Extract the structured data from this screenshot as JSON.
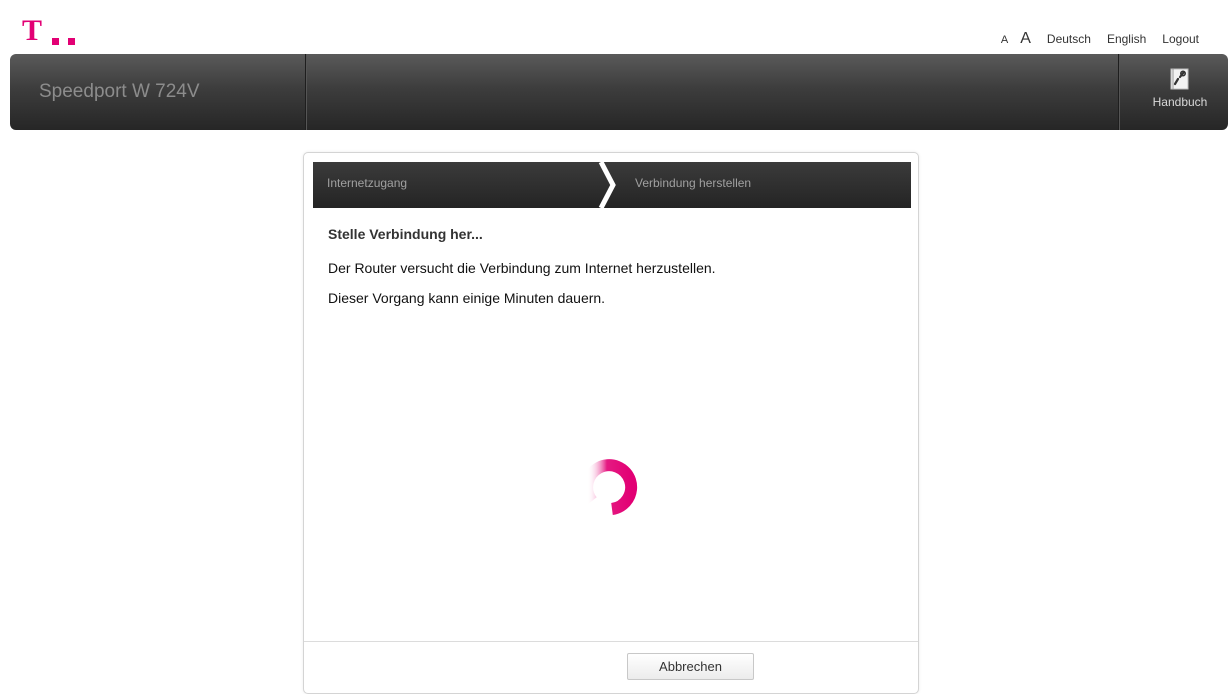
{
  "top_links": {
    "font_small": "A",
    "font_large": "A",
    "deutsch": "Deutsch",
    "english": "English",
    "logout": "Logout"
  },
  "header": {
    "title": "Speedport W 724V",
    "handbuch_label": "Handbuch",
    "handbuch_icon": "manual-book-wrench-icon"
  },
  "wizard": {
    "steps": [
      {
        "label": "Internetzugang"
      },
      {
        "label": "Verbindung herstellen"
      }
    ],
    "heading": "Stelle Verbindung her...",
    "message_line1": "Der Router versucht die Verbindung zum Internet herzustellen.",
    "message_line2": "Dieser Vorgang kann einige Minuten dauern.",
    "cancel_label": "Abbrechen"
  },
  "colors": {
    "brand": "#e20074",
    "header_bar": "#3a3a3a",
    "step_bar": "#2e2e2e"
  },
  "icons": {
    "logo": "telekom-logo",
    "spinner": "loading-spinner-icon"
  }
}
